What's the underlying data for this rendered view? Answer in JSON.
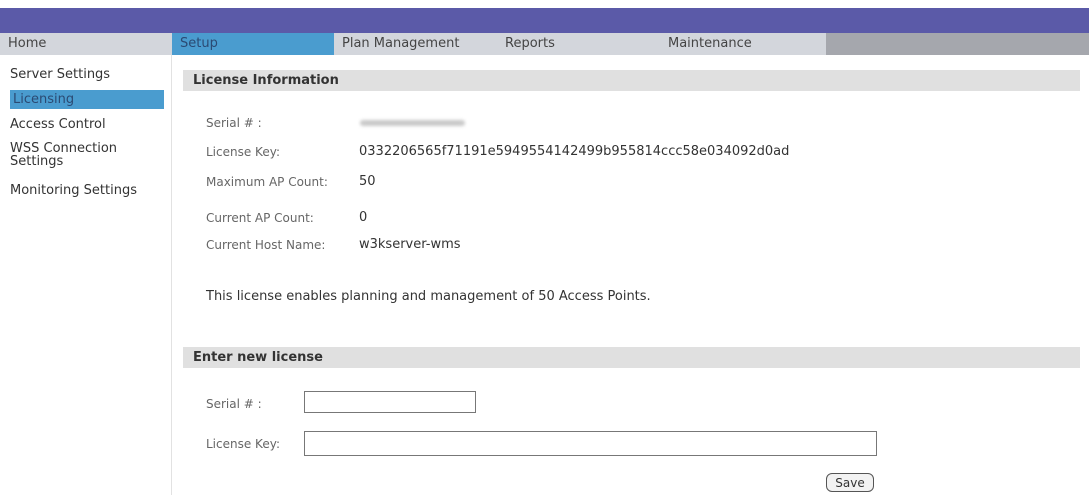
{
  "nav": {
    "tabs": [
      {
        "label": "Home"
      },
      {
        "label": "Setup"
      },
      {
        "label": "Plan Management"
      },
      {
        "label": "Reports"
      },
      {
        "label": "Maintenance"
      }
    ]
  },
  "sidebar": {
    "items": [
      {
        "label": "Server Settings"
      },
      {
        "label": "Licensing"
      },
      {
        "label": "Access Control"
      },
      {
        "label": "WSS Connection"
      },
      {
        "label": "Settings"
      },
      {
        "label": "Monitoring Settings"
      }
    ]
  },
  "license_info": {
    "header": "License Information",
    "serial_label": "Serial # :",
    "key_label": "License Key:",
    "key_value": "0332206565f71191e5949554142499b955814ccc58e034092d0ad",
    "max_label": "Maximum AP Count:",
    "max_value": "50",
    "current_label": "Current AP Count:",
    "current_value": "0",
    "host_label": "Current Host Name:",
    "host_value": "w3kserver-wms",
    "note": "This license enables planning and management of 50 Access Points."
  },
  "new_license": {
    "header": "Enter new license",
    "serial_label": "Serial # :",
    "serial_value": "",
    "key_label": "License Key:",
    "key_value": "",
    "save_label": "Save"
  }
}
